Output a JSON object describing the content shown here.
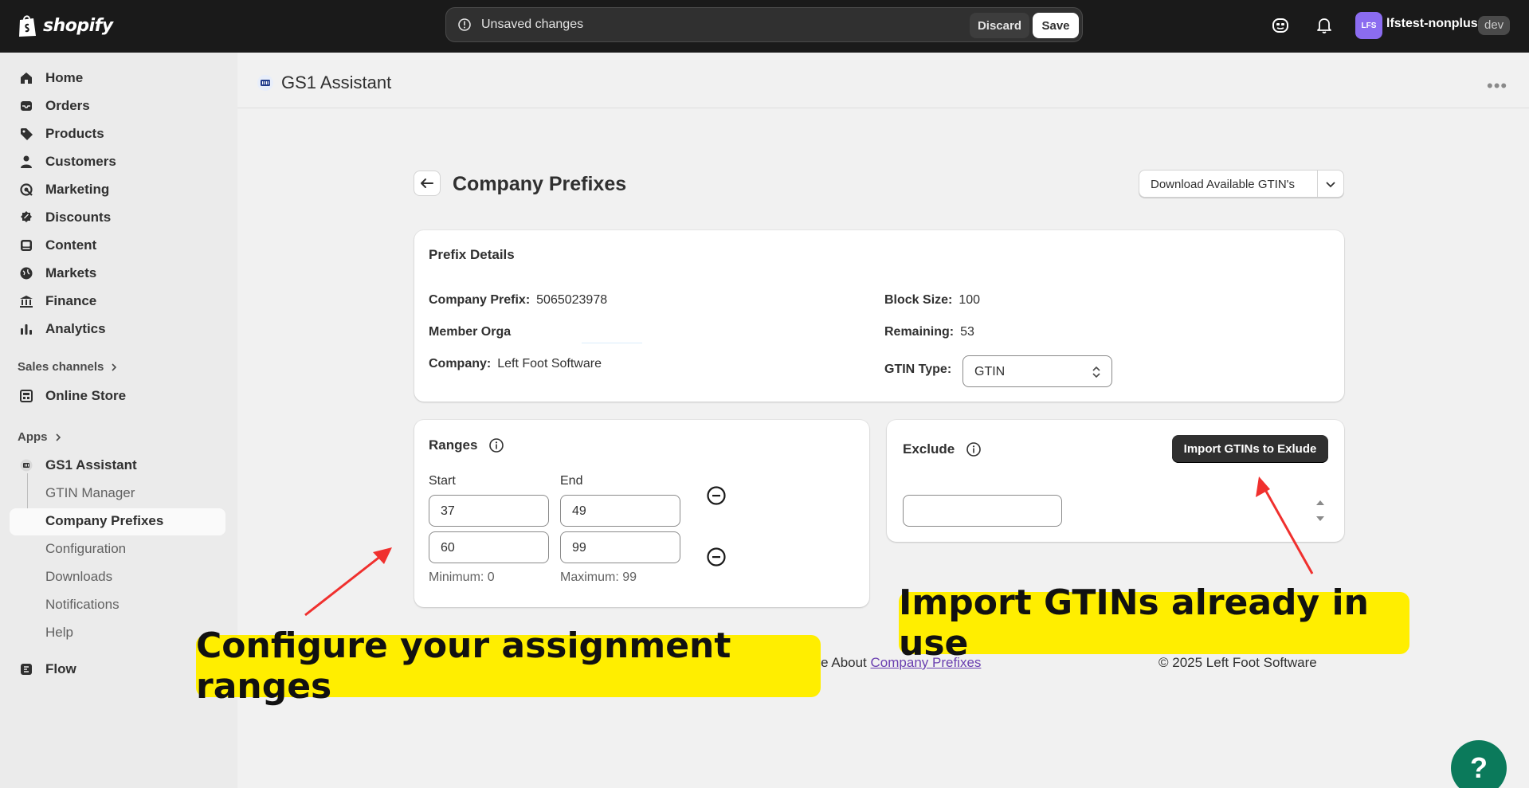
{
  "topbar": {
    "brand": "shopify",
    "unsaved_text": "Unsaved changes",
    "discard_label": "Discard",
    "save_label": "Save",
    "avatar_initials": "LFS",
    "store_name": "lfstest-nonplus",
    "env_badge": "dev",
    "icons": [
      "sidekick-icon",
      "bell-icon"
    ]
  },
  "sidebar": {
    "items": [
      {
        "label": "Home",
        "icon": "home-icon"
      },
      {
        "label": "Orders",
        "icon": "inbox-icon"
      },
      {
        "label": "Products",
        "icon": "tag-icon"
      },
      {
        "label": "Customers",
        "icon": "person-icon"
      },
      {
        "label": "Marketing",
        "icon": "target-icon"
      },
      {
        "label": "Discounts",
        "icon": "discount-icon"
      },
      {
        "label": "Content",
        "icon": "image-icon"
      },
      {
        "label": "Markets",
        "icon": "globe-icon"
      },
      {
        "label": "Finance",
        "icon": "bank-icon"
      },
      {
        "label": "Analytics",
        "icon": "bar-chart-icon"
      }
    ],
    "sales_channels_label": "Sales channels",
    "online_store_label": "Online Store",
    "apps_label": "Apps",
    "app_name": "GS1 Assistant",
    "app_sub_items": [
      "GTIN Manager",
      "Company Prefixes",
      "Configuration",
      "Downloads",
      "Notifications",
      "Help"
    ],
    "active_sub_item": "Company Prefixes",
    "flow_label": "Flow"
  },
  "header": {
    "app_title": "GS1 Assistant",
    "more_label": "•••"
  },
  "page": {
    "title": "Company Prefixes",
    "download_button": "Download Available GTIN's"
  },
  "prefix_details": {
    "title": "Prefix Details",
    "company_prefix_label": "Company Prefix:",
    "company_prefix_value": "5065023978",
    "member_org_label": "Member Orga",
    "company_label": "Company:",
    "company_value": "Left Foot Software",
    "block_size_label": "Block Size:",
    "block_size_value": "100",
    "remaining_label": "Remaining:",
    "remaining_value": "53",
    "gtin_type_label": "GTIN Type:",
    "gtin_type_value": "GTIN"
  },
  "ranges": {
    "title": "Ranges",
    "start_label": "Start",
    "end_label": "End",
    "rows": [
      {
        "start": "37",
        "end": "49"
      },
      {
        "start": "60",
        "end": "99"
      }
    ],
    "minimum_hint": "Minimum: 0",
    "maximum_hint": "Maximum: 99"
  },
  "exclude": {
    "title": "Exclude",
    "import_button": "Import GTINs to Exlude",
    "input_value": ""
  },
  "footer": {
    "learn_prefix": "ore About",
    "learn_link": "Company Prefixes",
    "copyright": "© 2025 Left Foot Software"
  },
  "callouts": {
    "ranges": "Configure your assignment ranges",
    "import": "Import GTINs already in use"
  },
  "help_fab": "?",
  "colors": {
    "topbar": "#1a1a1a",
    "callout": "#ffee00",
    "arrow": "#f0302e",
    "primary_button": "#303030",
    "fab": "#0b7a5b"
  }
}
